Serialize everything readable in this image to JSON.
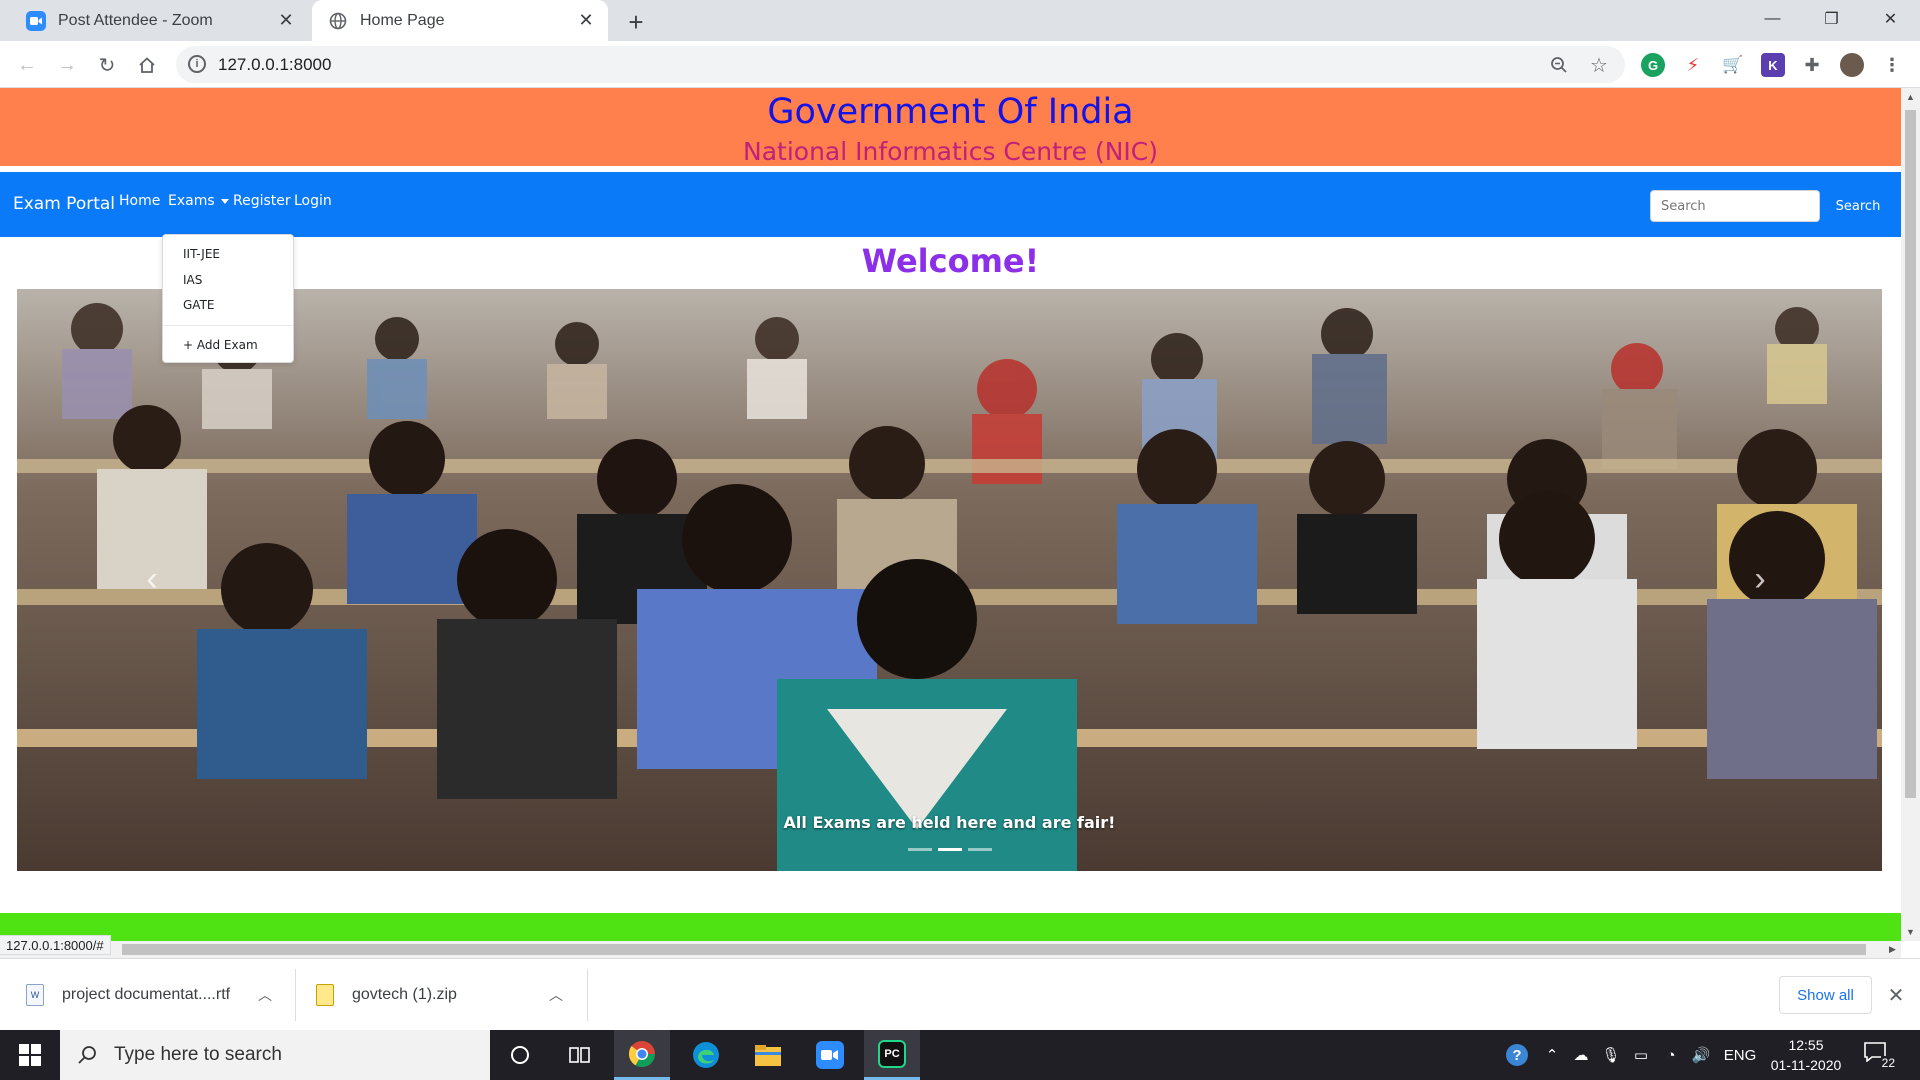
{
  "browser": {
    "tabs": [
      {
        "title": "Post Attendee - Zoom",
        "icon": "zoom-icon",
        "active": false
      },
      {
        "title": "Home Page",
        "icon": "globe-icon",
        "active": true
      }
    ],
    "url": "127.0.0.1:8000",
    "status_url": "127.0.0.1:8000/#"
  },
  "page": {
    "header_title": "Government Of India",
    "header_subtitle": "National Informatics Centre (NIC)",
    "brand": "Exam Portal",
    "nav": {
      "home": "Home",
      "exams": "Exams",
      "register": "Register",
      "login": "Login"
    },
    "search_placeholder": "Search",
    "search_button": "Search",
    "exams_menu": {
      "items": [
        "IIT-JEE",
        "IAS",
        "GATE"
      ],
      "add": "+ Add Exam"
    },
    "welcome": "Welcome!",
    "carousel": {
      "caption": "All Exams are held here and are fair!",
      "slides": 3,
      "active_slide": 2
    }
  },
  "downloads": {
    "items": [
      {
        "name": "project documentat....rtf",
        "icon": "word-doc-icon"
      },
      {
        "name": "govtech (1).zip",
        "icon": "zip-file-icon"
      }
    ],
    "show_all": "Show all"
  },
  "taskbar": {
    "search_placeholder": "Type here to search",
    "language": "ENG",
    "time": "12:55",
    "date": "01-11-2020",
    "notifications": "22"
  },
  "colors": {
    "header_bg": "#ff7f4d",
    "header_title": "#1414e6",
    "header_subtitle": "#c0207a",
    "navbar": "#0b7af8",
    "welcome": "#8b2fe8",
    "footer_bar": "#4fe314"
  }
}
